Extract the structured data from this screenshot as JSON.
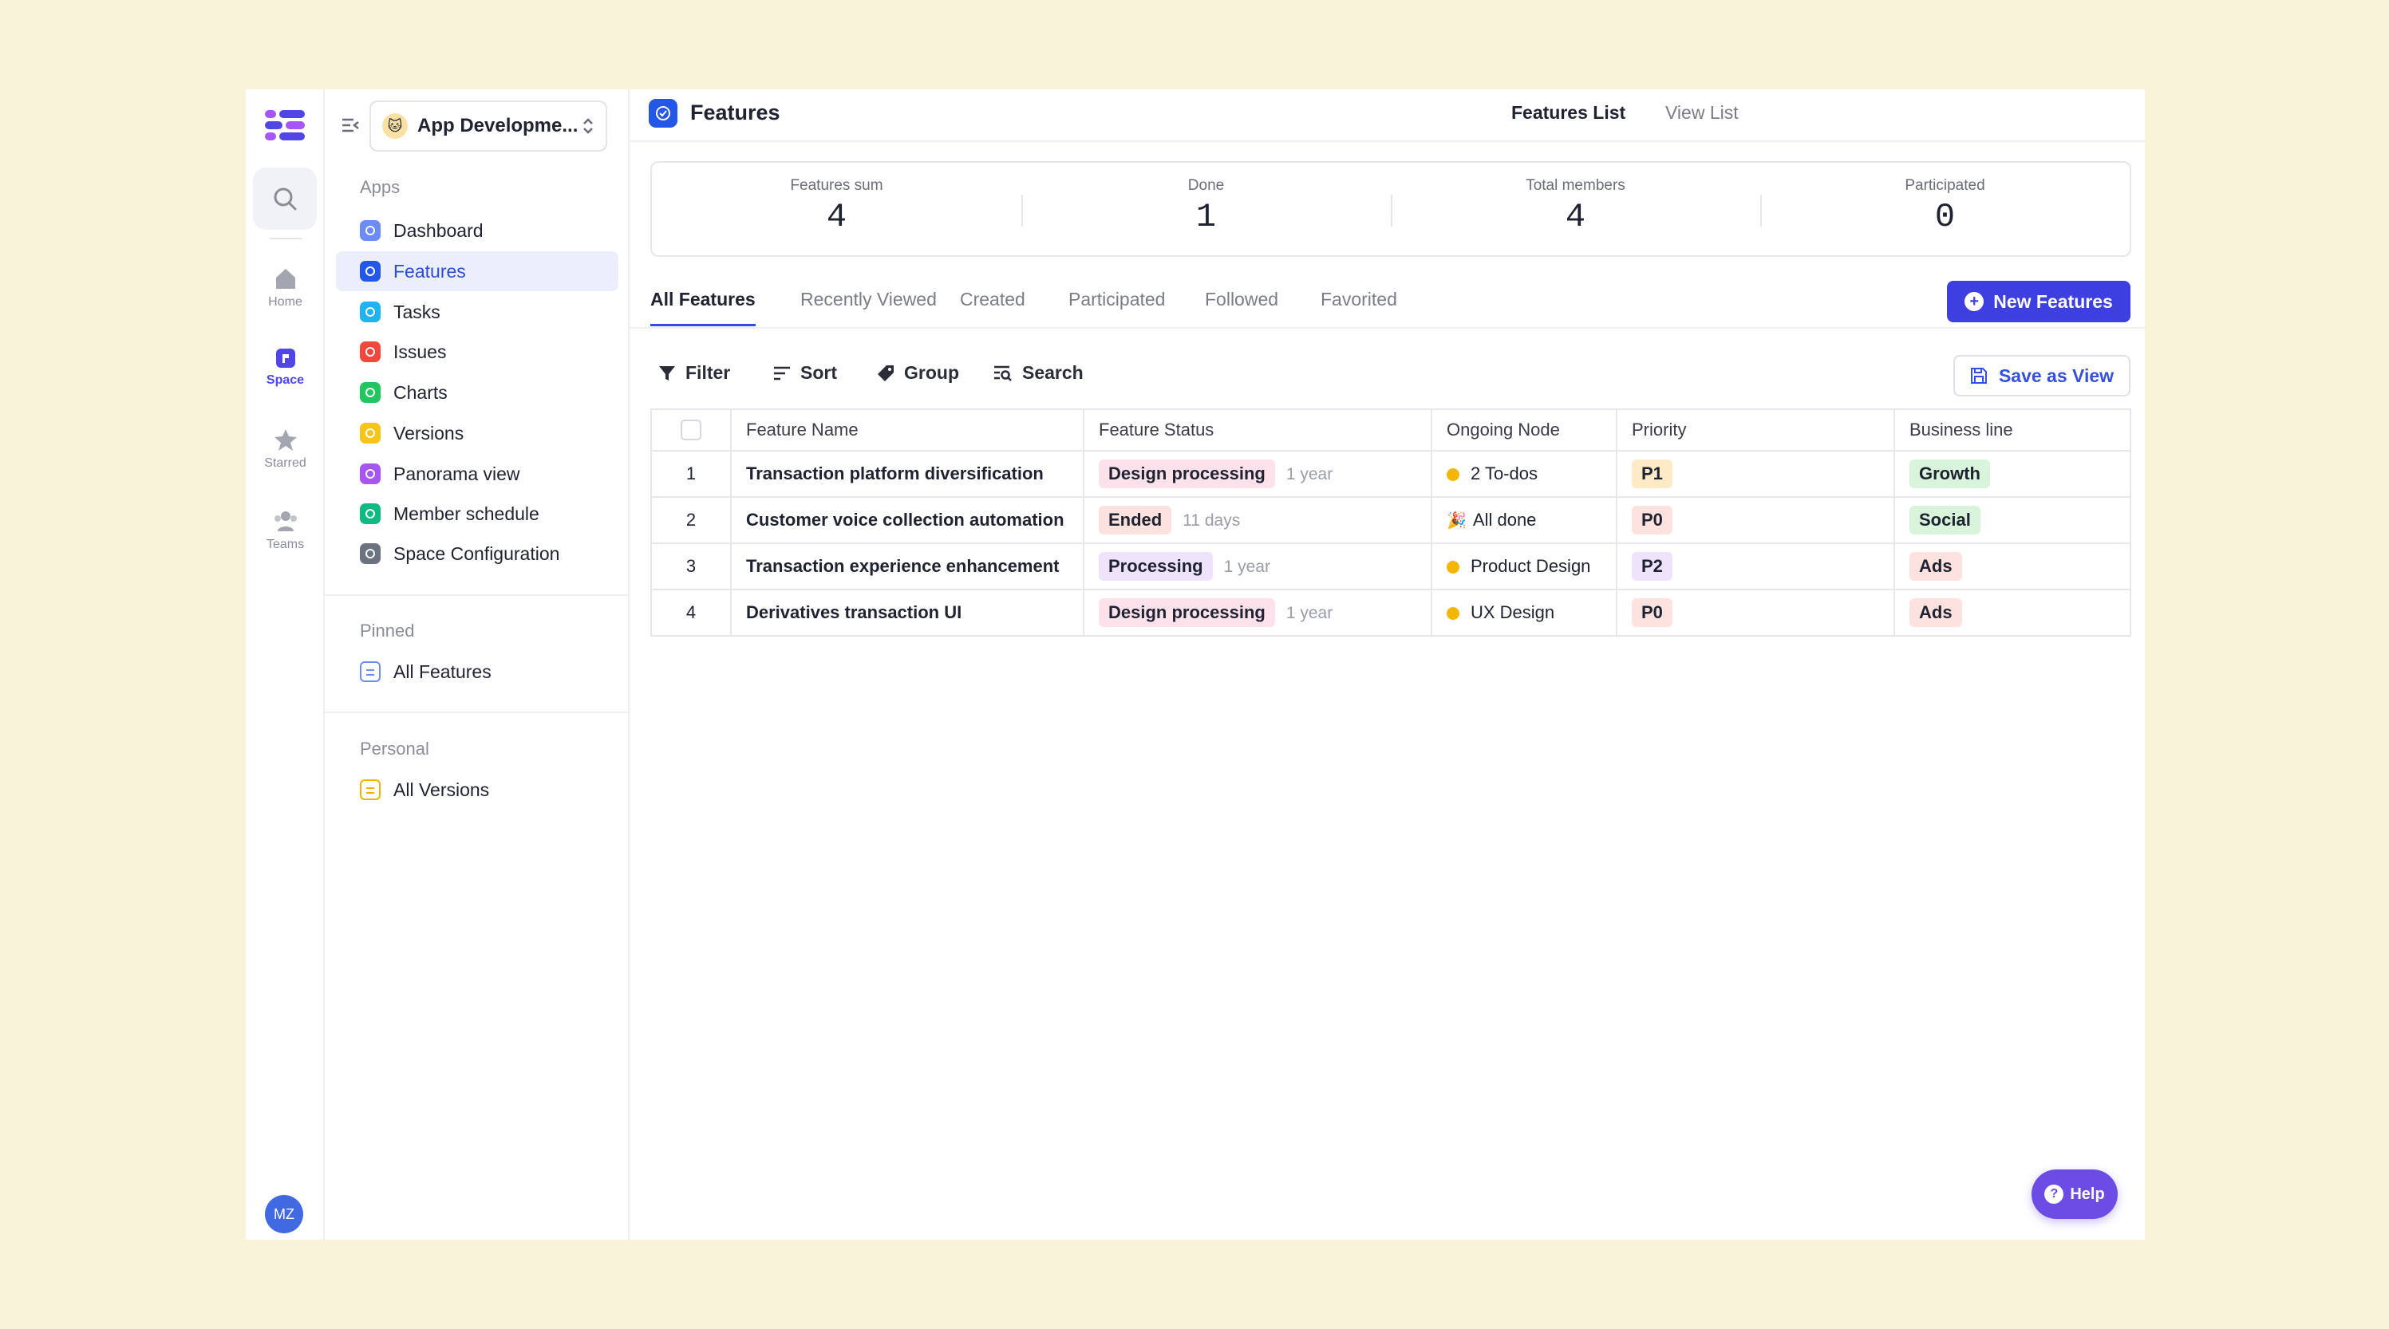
{
  "rail": {
    "items": [
      {
        "label": "Home",
        "icon": "home-icon"
      },
      {
        "label": "Space",
        "icon": "space-icon"
      },
      {
        "label": "Starred",
        "icon": "star-icon"
      },
      {
        "label": "Teams",
        "icon": "teams-icon"
      }
    ],
    "avatar": "MZ"
  },
  "sidebar": {
    "space_name": "App Developme...",
    "apps_label": "Apps",
    "apps": [
      {
        "label": "Dashboard",
        "color": "#6b8cf5"
      },
      {
        "label": "Features",
        "color": "#2456e8"
      },
      {
        "label": "Tasks",
        "color": "#1fb3f0"
      },
      {
        "label": "Issues",
        "color": "#f0483e"
      },
      {
        "label": "Charts",
        "color": "#22c55e"
      },
      {
        "label": "Versions",
        "color": "#f5c518"
      },
      {
        "label": "Panorama view",
        "color": "#a855f7"
      },
      {
        "label": "Member schedule",
        "color": "#10b981"
      },
      {
        "label": "Space Configuration",
        "color": "#6b7280"
      }
    ],
    "pinned_label": "Pinned",
    "pinned": [
      {
        "label": "All Features"
      }
    ],
    "personal_label": "Personal",
    "personal": [
      {
        "label": "All Versions"
      }
    ]
  },
  "header": {
    "title": "Features",
    "view_tabs": [
      "Features List",
      "View List"
    ]
  },
  "stats": [
    {
      "label": "Features sum",
      "value": "4"
    },
    {
      "label": "Done",
      "value": "1"
    },
    {
      "label": "Total members",
      "value": "4"
    },
    {
      "label": "Participated",
      "value": "0"
    }
  ],
  "tabs": [
    "All Features",
    "Recently Viewed",
    "Created",
    "Participated",
    "Followed",
    "Favorited"
  ],
  "new_button": "New Features",
  "toolbar": {
    "filter": "Filter",
    "sort": "Sort",
    "group": "Group",
    "search": "Search",
    "save_view": "Save as View"
  },
  "table": {
    "columns": [
      "Feature Name",
      "Feature Status",
      "Ongoing Node",
      "Priority",
      "Business line"
    ],
    "rows": [
      {
        "num": "1",
        "name": "Transaction platform diversification",
        "status": "Design processing",
        "status_bg": "#fde2ec",
        "time": "1 year",
        "node": "2 To-dos",
        "node_type": "dot",
        "priority": "P1",
        "priority_bg": "#fdebc8",
        "business": "Growth",
        "business_bg": "#d8f5dc"
      },
      {
        "num": "2",
        "name": "Customer voice collection automation",
        "status": "Ended",
        "status_bg": "#fde2e0",
        "time": "11 days",
        "node": "All done",
        "node_type": "party",
        "priority": "P0",
        "priority_bg": "#fde2e0",
        "business": "Social",
        "business_bg": "#d8f5dc"
      },
      {
        "num": "3",
        "name": "Transaction experience enhancement",
        "status": "Processing",
        "status_bg": "#efe3fb",
        "time": "1 year",
        "node": "Product Design",
        "node_type": "dot",
        "priority": "P2",
        "priority_bg": "#efe3fb",
        "business": "Ads",
        "business_bg": "#fde2e0"
      },
      {
        "num": "4",
        "name": "Derivatives transaction UI",
        "status": "Design processing",
        "status_bg": "#fde2ec",
        "time": "1 year",
        "node": "UX Design",
        "node_type": "dot",
        "priority": "P0",
        "priority_bg": "#fde2e0",
        "business": "Ads",
        "business_bg": "#fde2e0"
      }
    ]
  },
  "help": "Help"
}
